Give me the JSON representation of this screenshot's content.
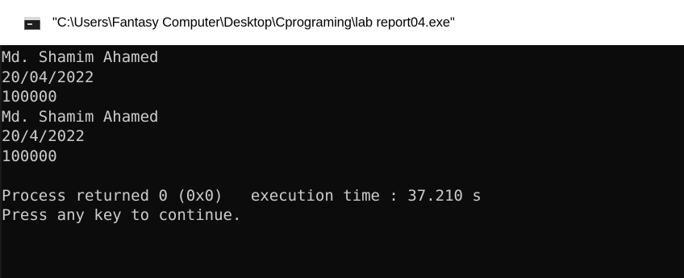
{
  "window": {
    "title": "\"C:\\Users\\Fantasy Computer\\Desktop\\Cprograming\\lab report04.exe\"",
    "icon": "console-app-icon"
  },
  "console": {
    "lines": [
      "Md. Shamim Ahamed",
      "20/04/2022",
      "100000",
      "Md. Shamim Ahamed",
      "20/4/2022",
      "100000",
      "",
      "Process returned 0 (0x0)   execution time : 37.210 s",
      "Press any key to continue."
    ],
    "text_color": "#cccccc",
    "background_color": "#0c0c0c"
  }
}
